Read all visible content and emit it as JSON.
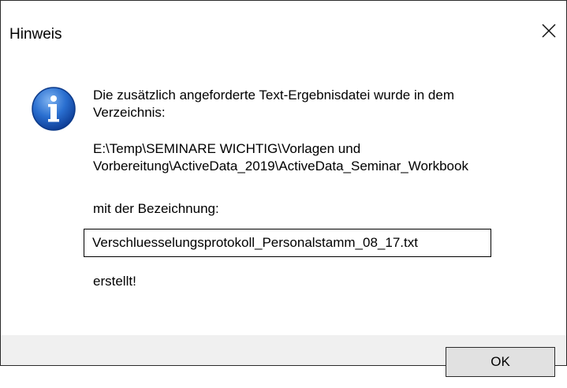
{
  "window": {
    "title": "Hinweis"
  },
  "message": {
    "line1": "Die zusätzlich angeforderte Text-Ergebnisdatei wurde in dem",
    "line2": "Verzeichnis:",
    "path_line1": "E:\\Temp\\SEMINARE WICHTIG\\Vorlagen und",
    "path_line2": "Vorbereitung\\ActiveData_2019\\ActiveData_Seminar_Workbook",
    "label_name": "mit der Bezeichnung:",
    "filename": "Verschluesselungsprotokoll_Personalstamm_08_17.txt",
    "created": "erstellt!"
  },
  "buttons": {
    "ok_label": "OK"
  },
  "icons": {
    "title_close": "close-icon",
    "info": "info-icon"
  },
  "colors": {
    "icon_blue": "#1c63c7",
    "footer_bg": "#f0f0f0",
    "button_bg": "#e1e1e1"
  }
}
